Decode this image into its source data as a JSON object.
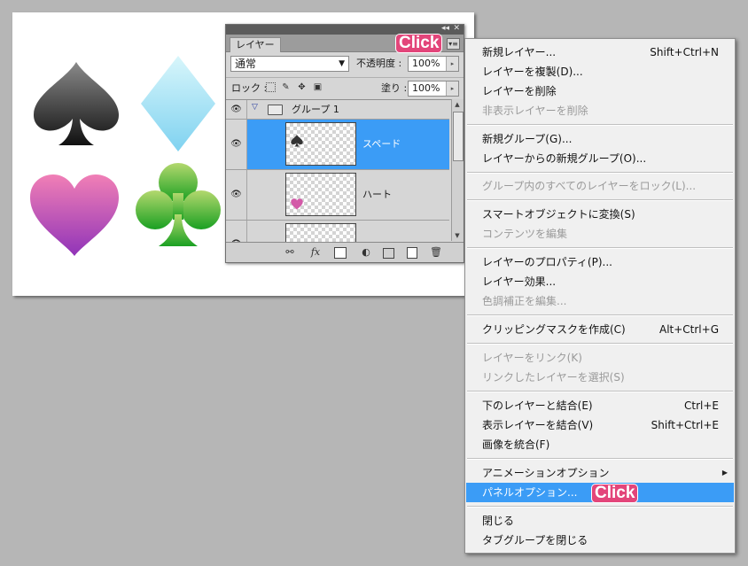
{
  "canvas": {
    "suits": [
      "spade",
      "diamond",
      "heart",
      "club"
    ]
  },
  "panel": {
    "tab_label": "レイヤー",
    "menu_icon": "panel-menu-icon",
    "blend_mode": "通常",
    "opacity_label": "不透明度 :",
    "opacity_value": "100%",
    "lock_label": "ロック :",
    "fill_label": "塗り :",
    "fill_value": "100%",
    "layers": [
      {
        "name": "グループ 1",
        "type": "group",
        "visible": true,
        "expanded": true
      },
      {
        "name": "スペード",
        "type": "layer",
        "visible": true,
        "selected": true
      },
      {
        "name": "ハート",
        "type": "layer",
        "visible": true,
        "selected": false
      }
    ],
    "footer_icons": [
      "link-icon",
      "fx-icon",
      "mask-icon",
      "adjustment-icon",
      "new-group-icon",
      "new-layer-icon",
      "trash-icon"
    ]
  },
  "menu": {
    "items": [
      {
        "label": "新規レイヤー...",
        "shortcut": "Shift+Ctrl+N"
      },
      {
        "label": "レイヤーを複製(D)..."
      },
      {
        "label": "レイヤーを削除"
      },
      {
        "label": "非表示レイヤーを削除",
        "disabled": true
      },
      {
        "label": "新規グループ(G)..."
      },
      {
        "label": "レイヤーからの新規グループ(O)..."
      },
      {
        "label": "グループ内のすべてのレイヤーをロック(L)...",
        "disabled": true
      },
      {
        "label": "スマートオブジェクトに変換(S)"
      },
      {
        "label": "コンテンツを編集",
        "disabled": true
      },
      {
        "label": "レイヤーのプロパティ(P)..."
      },
      {
        "label": "レイヤー効果..."
      },
      {
        "label": "色調補正を編集...",
        "disabled": true
      },
      {
        "label": "クリッピングマスクを作成(C)",
        "shortcut": "Alt+Ctrl+G"
      },
      {
        "label": "レイヤーをリンク(K)",
        "disabled": true
      },
      {
        "label": "リンクしたレイヤーを選択(S)",
        "disabled": true
      },
      {
        "label": "下のレイヤーと結合(E)",
        "shortcut": "Ctrl+E"
      },
      {
        "label": "表示レイヤーを結合(V)",
        "shortcut": "Shift+Ctrl+E"
      },
      {
        "label": "画像を統合(F)"
      },
      {
        "label": "アニメーションオプション",
        "submenu": true
      },
      {
        "label": "パネルオプション...",
        "highlighted": true
      },
      {
        "label": "閉じる"
      },
      {
        "label": "タブグループを閉じる"
      }
    ]
  },
  "annotations": {
    "click_1": "Click",
    "click_2": "Click",
    "badge_color": "#e3457a",
    "highlight_color": "#3b9cf6"
  }
}
